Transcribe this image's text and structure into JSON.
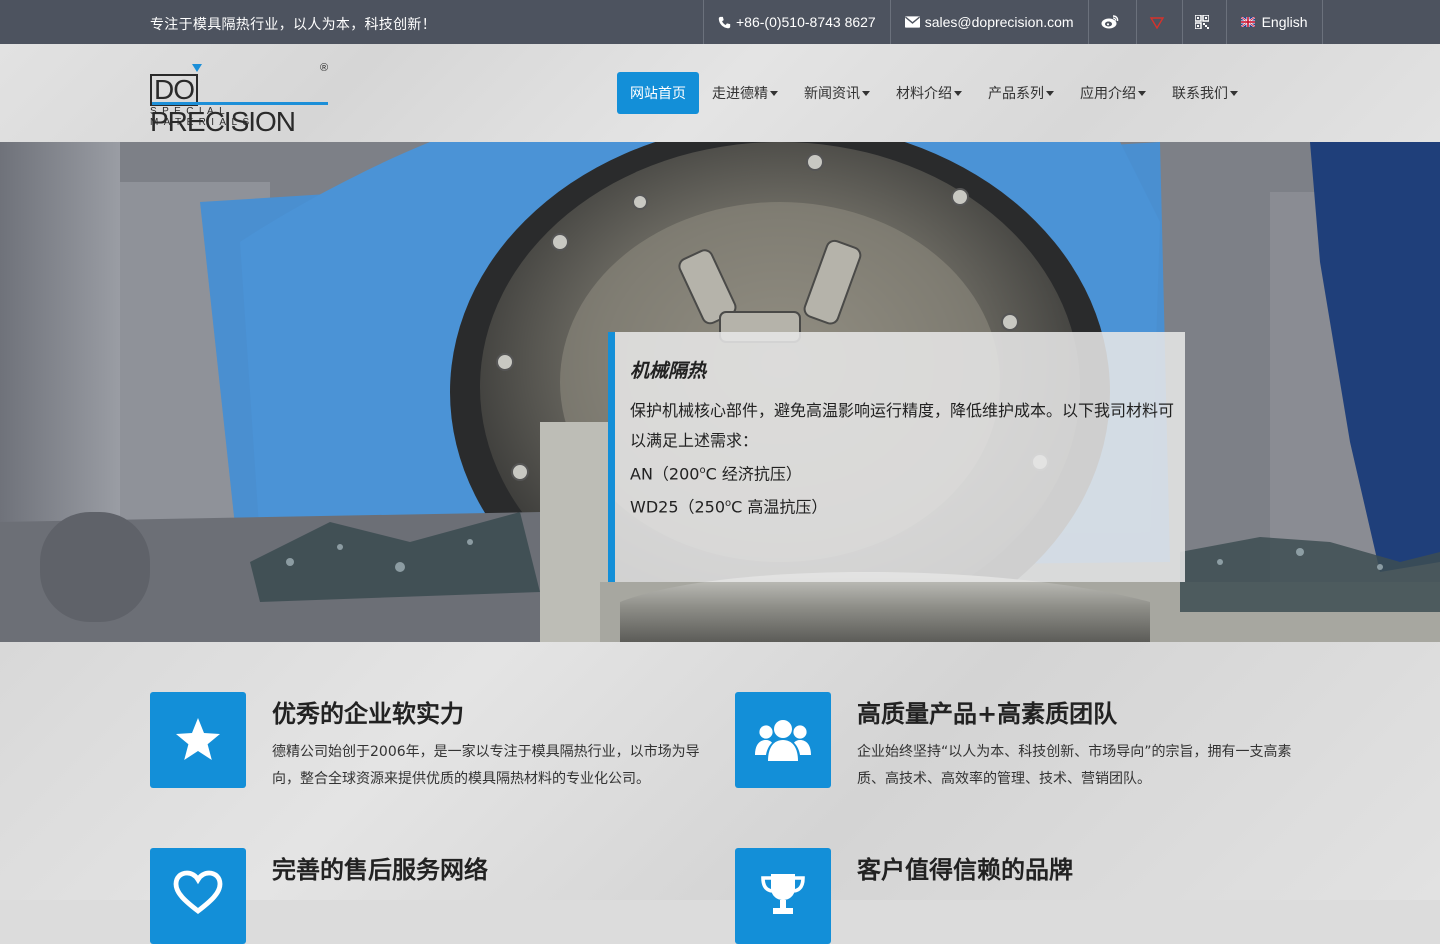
{
  "topbar": {
    "slogan": "专注于模具隔热行业，以人为本，科技创新！",
    "phone": "+86-(0)510-8743 8627",
    "email": "sales@doprecision.com",
    "weibo_icon": "weibo-icon",
    "tmall_icon": "tmall-icon",
    "qrcode_icon": "qrcode-icon",
    "language": "English"
  },
  "logo": {
    "mark_do": "DO",
    "mark_precision": "PRECISION",
    "registered": "®",
    "tagline": "SPECIAL MATERIALS"
  },
  "nav": {
    "items": [
      {
        "label": "网站首页",
        "active": true
      },
      {
        "label": "走进德精",
        "active": false
      },
      {
        "label": "新闻资讯",
        "active": false
      },
      {
        "label": "材料介绍",
        "active": false
      },
      {
        "label": "产品系列",
        "active": false
      },
      {
        "label": "应用介绍",
        "active": false
      },
      {
        "label": "联系我们",
        "active": false
      }
    ]
  },
  "hero": {
    "title": "机械隔热",
    "body": "保护机械核心部件，避免高温影响运行精度，降低维护成本。以下我司材料可以满足上述需求：",
    "line1_pre": "AN（200",
    "line1_sup": "o",
    "line1_post": "C 经济抗压）",
    "line2_pre": "WD25（250",
    "line2_sup": "o",
    "line2_post": "C 高温抗压）"
  },
  "features": [
    {
      "icon": "star-icon",
      "title": "优秀的企业软实力",
      "text": "德精公司始创于2006年，是一家以专注于模具隔热行业，以市场为导向，整合全球资源来提供优质的模具隔热材料的专业化公司。"
    },
    {
      "icon": "users-icon",
      "title": "高质量产品+高素质团队",
      "text": "企业始终坚持“以人为本、科技创新、市场导向”的宗旨，拥有一支高素质、高技术、高效率的管理、技术、营销团队。"
    },
    {
      "icon": "heart-icon",
      "title": "完善的售后服务网络",
      "text": ""
    },
    {
      "icon": "trophy-icon",
      "title": "客户值得信赖的品牌",
      "text": ""
    }
  ],
  "colors": {
    "accent": "#138fd8",
    "topbar": "#4d535f"
  }
}
